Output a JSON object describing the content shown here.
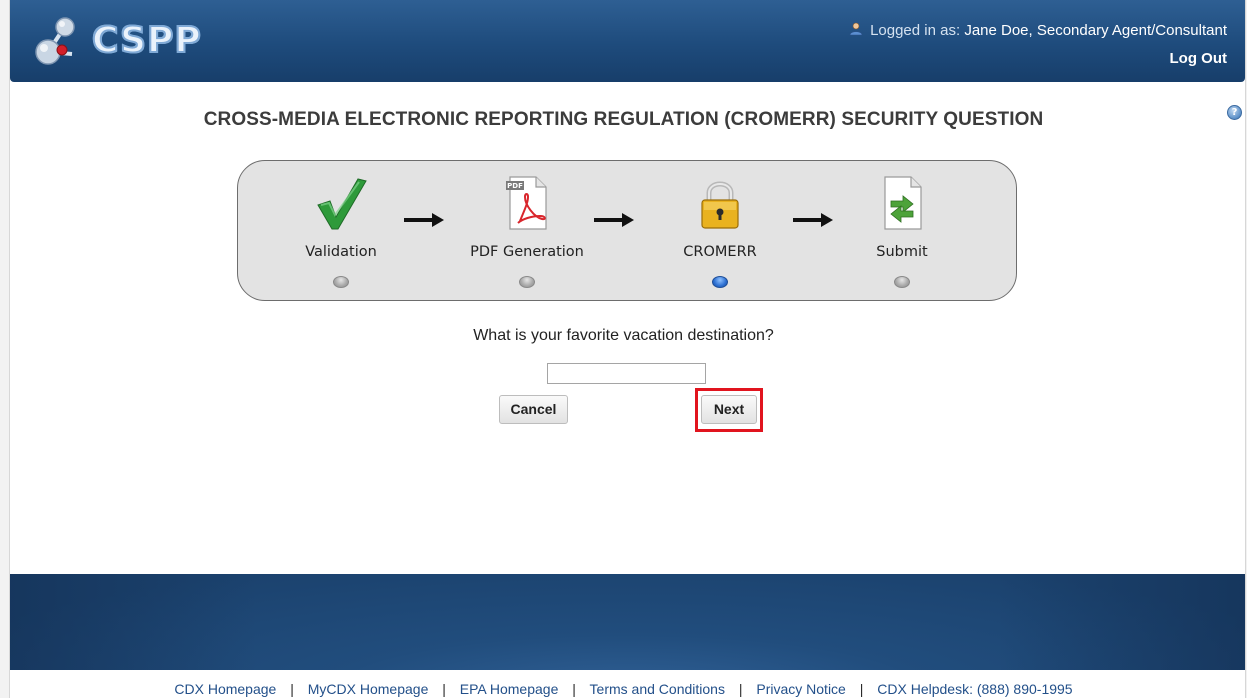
{
  "header": {
    "logo_text": "CSPP",
    "logged_in_prefix": "Logged in as:",
    "user_name": "Jane Doe, Secondary Agent/Consultant",
    "logout_label": "Log Out"
  },
  "page": {
    "title": "CROSS-MEDIA ELECTRONIC REPORTING REGULATION (CROMERR) SECURITY QUESTION",
    "help_label": "?"
  },
  "steps": [
    {
      "label": "Validation",
      "icon": "checkmark-icon",
      "active": false
    },
    {
      "label": "PDF Generation",
      "icon": "pdf-document-icon",
      "active": false
    },
    {
      "label": "CROMERR",
      "icon": "padlock-icon",
      "active": true
    },
    {
      "label": "Submit",
      "icon": "submit-document-icon",
      "active": false
    }
  ],
  "question": {
    "text": "What is your favorite vacation destination?",
    "answer_value": "",
    "answer_placeholder": ""
  },
  "buttons": {
    "cancel_label": "Cancel",
    "next_label": "Next"
  },
  "footer": {
    "links": [
      "CDX Homepage",
      "MyCDX Homepage",
      "EPA Homepage",
      "Terms and Conditions",
      "Privacy Notice",
      "CDX Helpdesk: (888) 890-1995"
    ],
    "separator": "|"
  },
  "colors": {
    "header_blue": "#1e4b7c",
    "highlight_red": "#e1141e",
    "active_dot_blue": "#2c6fd1",
    "link_blue": "#23508a"
  }
}
